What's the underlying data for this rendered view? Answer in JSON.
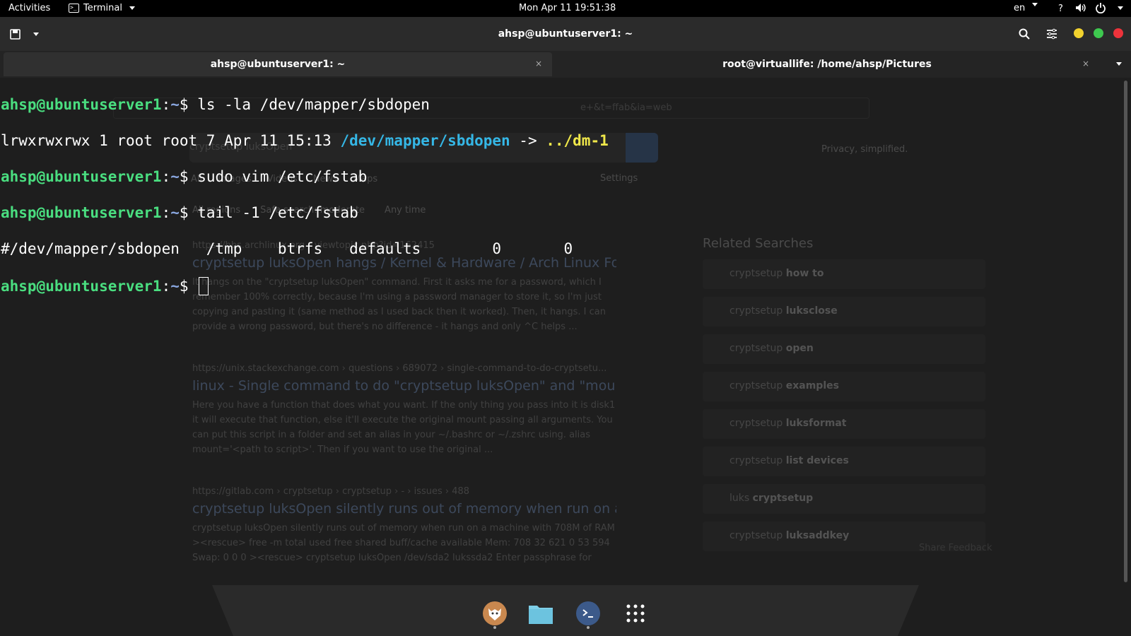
{
  "topbar": {
    "activities": "Activities",
    "app_menu": "Terminal",
    "clock": "Mon Apr 11  19:51:38",
    "language": "en"
  },
  "window": {
    "title": "ahsp@ubuntuserver1: ~",
    "controls": {
      "minimize_color": "#f2d22e",
      "maximize_color": "#3ec84f",
      "close_color": "#ed333b"
    }
  },
  "tabs": [
    {
      "label": "ahsp@ubuntuserver1: ~",
      "active": true,
      "close": "×"
    },
    {
      "label": "root@virtuallife: /home/ahsp/Pictures",
      "active": false,
      "close": "×"
    }
  ],
  "terminal": {
    "prompt_user": "ahsp@ubuntuserver1",
    "prompt_sep": ":",
    "prompt_path": "~",
    "prompt_symbol": "$ ",
    "lines": [
      {
        "command": "ls -la /dev/mapper/sbdopen"
      },
      {
        "output_prefix": "lrwxrwxrwx 1 root root 7 Apr 11 15:13 ",
        "link": "/dev/mapper/sbdopen",
        "arrow": " -> ",
        "target": "../dm-1"
      },
      {
        "command": "sudo vim /etc/fstab"
      },
      {
        "command": "tail -1 /etc/fstab"
      },
      {
        "output": "#/dev/mapper/sbdopen   /tmp    btrfs   defaults        0       0"
      }
    ]
  },
  "background_browser": {
    "address_fragment": "e+&t=ffab&ia=web",
    "search_query": "cryptsetup luksOpen",
    "privacy": "Privacy, simplified.",
    "nav": [
      "All",
      "Images",
      "Videos",
      "News",
      "Maps"
    ],
    "settings": "Settings",
    "filters": [
      "All regions",
      "Safe search: moderate",
      "Any time"
    ],
    "results": [
      {
        "url": "https://bbs.archlinux.org › viewtopic.php?id=162415",
        "title": "cryptsetup luksOpen hangs / Kernel & Hardware / Arch Linux Fo...",
        "snippet": "It hangs on the \"cryptsetup luksOpen\" command. First it asks me for a password, which I remember 100% correctly, because I'm using a password manager to store it, so I'm just copying and pasting it (same method as I used back then it worked). Then, it hangs. I can provide a wrong password, but there's no difference - it hangs and only ^C helps ..."
      },
      {
        "url": "https://unix.stackexchange.com › questions › 689072 › single-command-to-do-cryptsetu...",
        "title": "linux - Single command to do \"cryptsetup luksOpen\" and \"moun...",
        "snippet": "Here you have a function that does what you want. If the only thing you pass into it is disk1 it will execute that function, else it'll execute the original mount passing all arguments. You can put this script in a folder and set an alias in your ~/.bashrc or ~/.zshrc using. alias mount='<path to script>'. Then if you want to use the original ..."
      },
      {
        "url": "https://gitlab.com › cryptsetup › cryptsetup › - › issues › 488",
        "title": "cryptsetup luksOpen silently runs out of memory when run on a...",
        "snippet": "cryptsetup luksOpen silently runs out of memory when run on a machine with 708M of RAM ><rescue> free -m total used free shared buff/cache available Mem: 708 32 621 0 53 594 Swap: 0 0 0 ><rescue> cryptsetup luksOpen /dev/sda2 lukssda2 Enter passphrase for"
      }
    ],
    "related_title": "Related Searches",
    "related": [
      {
        "prefix": "cryptsetup ",
        "bold": "how to"
      },
      {
        "prefix": "cryptsetup ",
        "bold": "luksclose"
      },
      {
        "prefix": "cryptsetup ",
        "bold": "open"
      },
      {
        "prefix": "cryptsetup ",
        "bold": "examples"
      },
      {
        "prefix": "cryptsetup ",
        "bold": "luksformat"
      },
      {
        "prefix": "cryptsetup ",
        "bold": "list devices"
      },
      {
        "prefix": "luks ",
        "bold": "cryptsetup"
      },
      {
        "prefix": "cryptsetup ",
        "bold": "luksaddkey"
      }
    ],
    "share_feedback": "Share Feedback"
  },
  "dock": {
    "items": [
      "firefox-icon",
      "files-icon",
      "terminal-icon",
      "app-grid-icon"
    ]
  }
}
